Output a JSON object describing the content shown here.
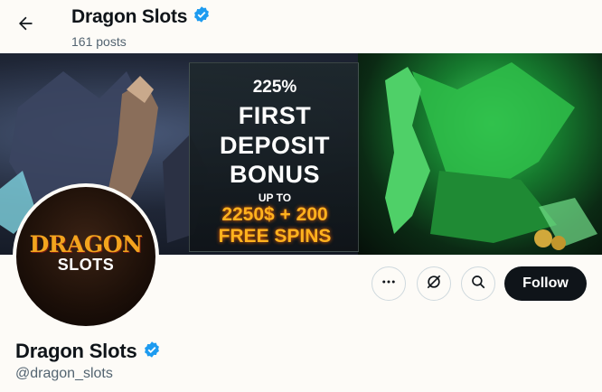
{
  "header": {
    "title": "Dragon Slots",
    "posts_count": "161 posts",
    "verified_icon": "verified-badge-icon",
    "back_icon": "arrow-left-icon"
  },
  "banner": {
    "line1": "225%",
    "line2": "FIRST",
    "line3": "DEPOSIT",
    "line4": "BONUS",
    "line5": "UP TO",
    "line6": "2250$ + 200",
    "line7": "FREE SPINS"
  },
  "avatar": {
    "logo_top": "DRAGON",
    "logo_bottom": "SLOTS"
  },
  "actions": {
    "more_icon": "more-dots-icon",
    "grok_icon": "grok-icon",
    "search_icon": "search-icon",
    "follow_label": "Follow"
  },
  "profile": {
    "name": "Dragon Slots",
    "handle": "@dragon_slots"
  },
  "colors": {
    "verified": "#1d9bf0",
    "follow_bg": "#0f1419",
    "secondary_text": "#536471",
    "bonus_text": "#ffb21e"
  }
}
